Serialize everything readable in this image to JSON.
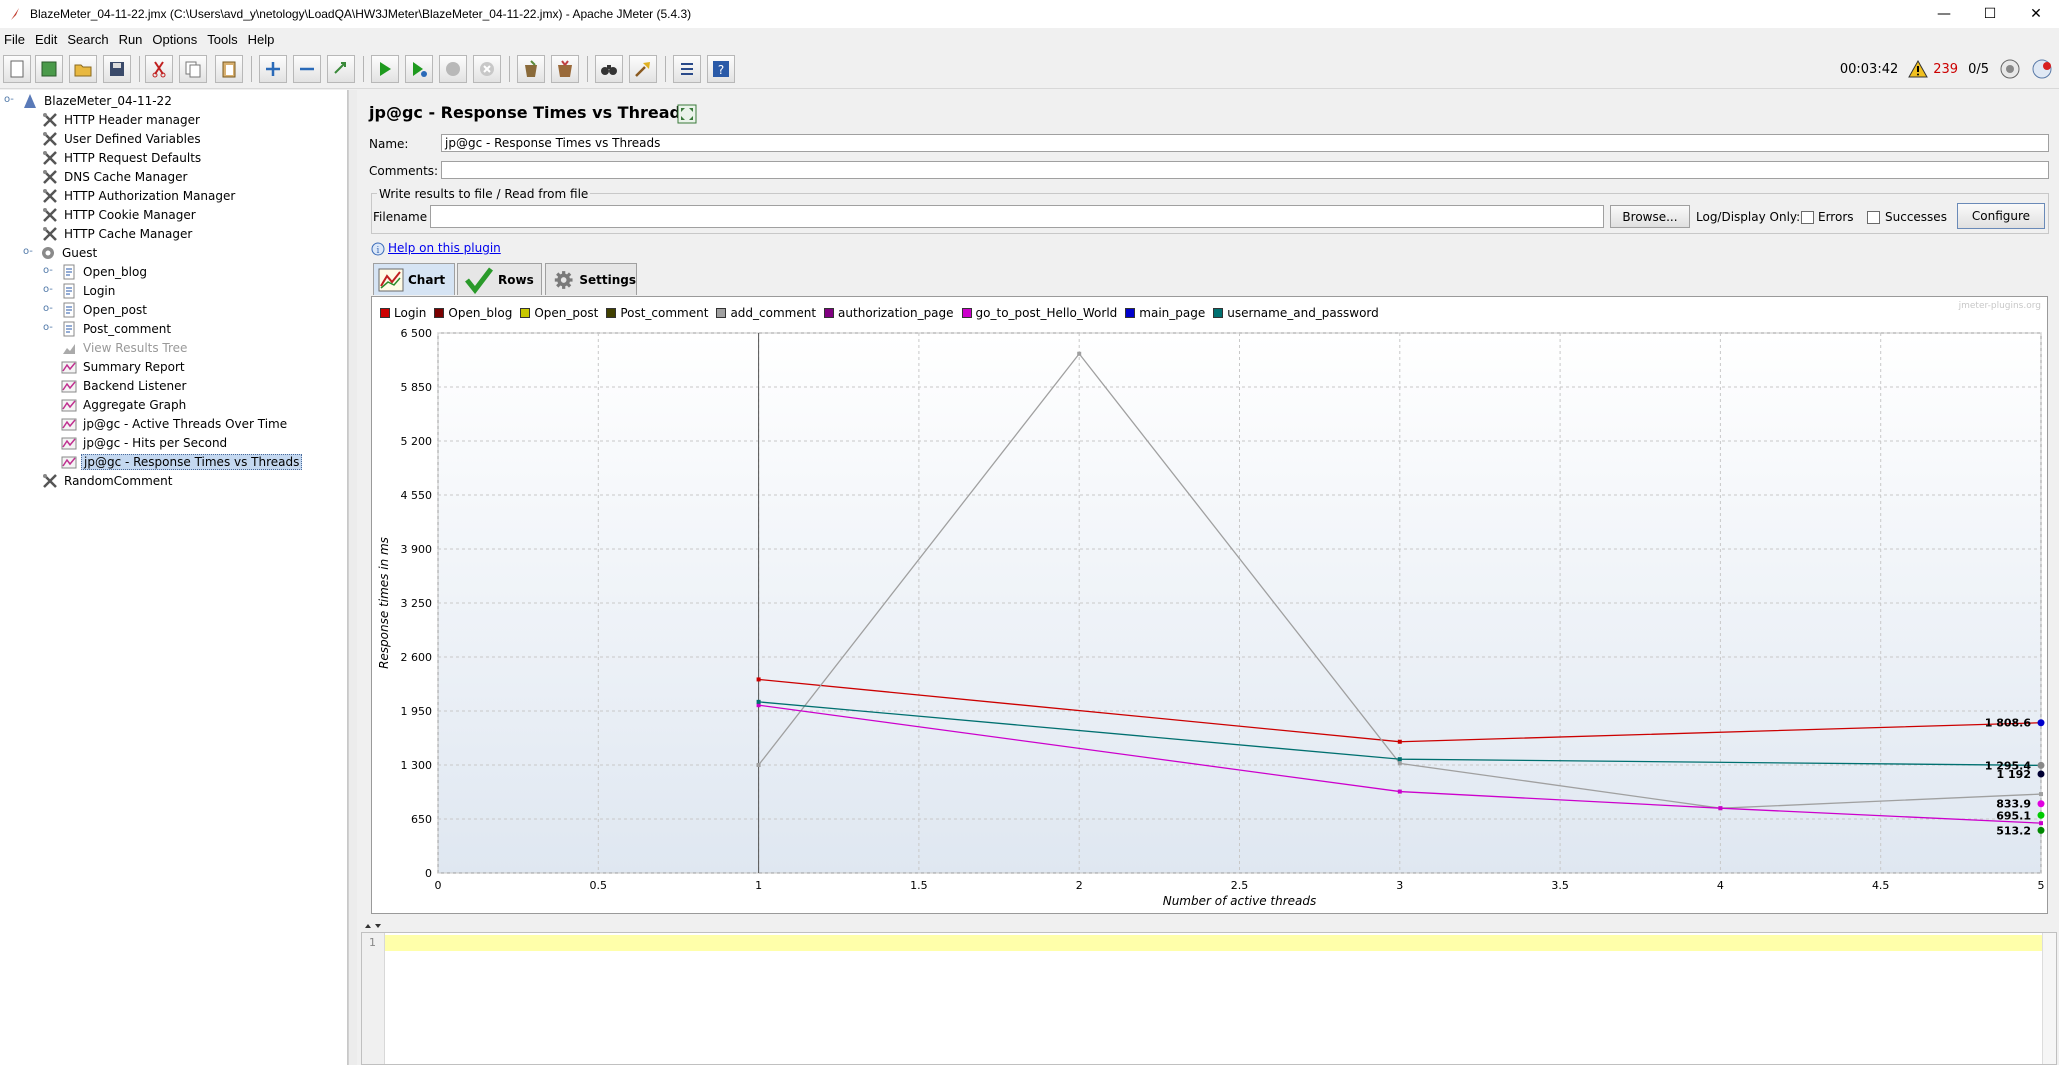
{
  "window": {
    "title": "BlazeMeter_04-11-22.jmx (C:\\Users\\avd_y\\netology\\LoadQA\\HW3JMeter\\BlazeMeter_04-11-22.jmx) - Apache JMeter (5.4.3)",
    "minimize": "—",
    "maximize": "☐",
    "close": "✕"
  },
  "menu": [
    "File",
    "Edit",
    "Search",
    "Run",
    "Options",
    "Tools",
    "Help"
  ],
  "status": {
    "elapsed": "00:03:42",
    "warnings": "239",
    "threads": "0/5"
  },
  "tree": {
    "root": "BlazeMeter_04-11-22",
    "items": [
      "HTTP Header manager",
      "User Defined Variables",
      "HTTP Request Defaults",
      "DNS Cache Manager",
      "HTTP Authorization Manager",
      "HTTP Cookie Manager",
      "HTTP Cache Manager"
    ],
    "group": "Guest",
    "group_items": [
      "Open_blog",
      "Login",
      "Open_post",
      "Post_comment",
      "View Results Tree",
      "Summary Report",
      "Backend Listener",
      "Aggregate Graph",
      "jp@gc - Active Threads Over Time",
      "jp@gc - Hits per Second",
      "jp@gc - Response Times vs Threads"
    ],
    "last": "RandomComment"
  },
  "panel": {
    "title": "jp@gc - Response Times vs Threads",
    "name_label": "Name:",
    "name_value": "jp@gc - Response Times vs Threads",
    "comments_label": "Comments:",
    "comments_value": "",
    "file_group": "Write results to file / Read from file",
    "filename_label": "Filename",
    "filename_value": "",
    "browse": "Browse...",
    "log_only": "Log/Display Only:",
    "errors": "Errors",
    "successes": "Successes",
    "configure": "Configure",
    "help_link": "Help on this plugin",
    "tabs": [
      "Chart",
      "Rows",
      "Settings"
    ],
    "watermark": "jmeter-plugins.org"
  },
  "chart_data": {
    "type": "line",
    "xlabel": "Number of active threads",
    "ylabel": "Response times in ms",
    "xlim": [
      0,
      5
    ],
    "ylim": [
      0,
      6500
    ],
    "x_ticks": [
      "0",
      "0.5",
      "1",
      "1.5",
      "2",
      "2.5",
      "3",
      "3.5",
      "4",
      "4.5",
      "5"
    ],
    "y_ticks": [
      "0",
      "650",
      "1 300",
      "1 950",
      "2 600",
      "3 250",
      "3 900",
      "4 550",
      "5 200",
      "5 850",
      "6 500"
    ],
    "grid": true,
    "legend_position": "top",
    "series": [
      {
        "name": "Login",
        "color": "#cc0000",
        "points": [
          [
            1,
            2330
          ],
          [
            3,
            1580
          ],
          [
            5,
            1808.6
          ]
        ]
      },
      {
        "name": "Open_blog",
        "color": "#7a0000",
        "points": []
      },
      {
        "name": "Open_post",
        "color": "#c8c800",
        "points": []
      },
      {
        "name": "Post_comment",
        "color": "#404000",
        "points": []
      },
      {
        "name": "add_comment",
        "color": "#a0a0a0",
        "points": [
          [
            1,
            1300
          ],
          [
            2,
            6250
          ],
          [
            3,
            1320
          ],
          [
            4,
            780
          ],
          [
            5,
            950
          ]
        ]
      },
      {
        "name": "authorization_page",
        "color": "#800080",
        "points": []
      },
      {
        "name": "go_to_post_Hello_World",
        "color": "#cc00cc",
        "points": [
          [
            1,
            2020
          ],
          [
            3,
            980
          ],
          [
            4,
            780
          ],
          [
            5,
            600
          ]
        ]
      },
      {
        "name": "main_page",
        "color": "#0000cc",
        "points": []
      },
      {
        "name": "username_and_password",
        "color": "#007070",
        "points": [
          [
            1,
            2060
          ],
          [
            3,
            1370
          ],
          [
            5,
            1295.4
          ]
        ]
      }
    ],
    "end_labels": [
      {
        "text": "1 808.6",
        "value": 1808.6,
        "color": "#0000cc"
      },
      {
        "text": "1 295.4",
        "value": 1295.4,
        "color": "#888888"
      },
      {
        "text": "1 192",
        "value": 1192,
        "color": "#000033"
      },
      {
        "text": "833.9",
        "value": 833.9,
        "color": "#e000e0"
      },
      {
        "text": "695.1",
        "value": 695.1,
        "color": "#00cc00"
      },
      {
        "text": "513.2",
        "value": 513.2,
        "color": "#008800"
      }
    ]
  },
  "console": {
    "line_number": "1"
  }
}
